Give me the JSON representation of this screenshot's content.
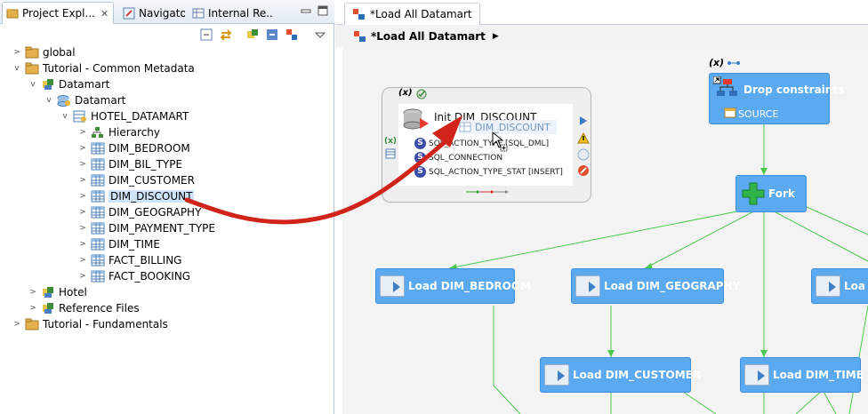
{
  "left_panel": {
    "tabs": [
      {
        "label": "Project Expl...",
        "close": "✕"
      },
      {
        "label": "Navigator"
      },
      {
        "label": "Internal Re..."
      }
    ],
    "tree": [
      {
        "label": "global"
      },
      {
        "label": "Tutorial - Common Metadata"
      },
      {
        "label": "Datamart"
      },
      {
        "label": "Datamart"
      },
      {
        "label": "HOTEL_DATAMART"
      },
      {
        "label": "Hierarchy"
      },
      {
        "label": "DIM_BEDROOM"
      },
      {
        "label": "DIM_BIL_TYPE"
      },
      {
        "label": "DIM_CUSTOMER"
      },
      {
        "label": "DIM_DISCOUNT"
      },
      {
        "label": "DIM_GEOGRAPHY"
      },
      {
        "label": "DIM_PAYMENT_TYPE"
      },
      {
        "label": "DIM_TIME"
      },
      {
        "label": "FACT_BILLING"
      },
      {
        "label": "FACT_BOOKING"
      },
      {
        "label": "Hotel"
      },
      {
        "label": "Reference Files"
      },
      {
        "label": "Tutorial - Fundamentals"
      }
    ]
  },
  "editor": {
    "tab_label": "*Load All Datamart",
    "breadcrumb": "*Load All Datamart",
    "variable_badge": "(x)",
    "init_node": {
      "title": "Init DIM_DISCOUNT",
      "drag_label": "DIM_DISCOUNT",
      "params": [
        "SQL_ACTION_TYPE [SQL_DML]",
        "SQL_CONNECTION",
        "SQL_ACTION_TYPE_STAT [INSERT]"
      ]
    },
    "drop_node": {
      "label": "Drop constraints",
      "sub": "SOURCE"
    },
    "fork_node": {
      "label": "Fork"
    },
    "load_nodes": [
      "Load DIM_BEDROOM",
      "Load DIM_GEOGRAPHY",
      "Loa",
      "Load DIM_CUSTOMER",
      "Load DIM_TIME"
    ]
  },
  "colors": {
    "node_blue": "#5aa9f1",
    "link_green": "#4cc94c",
    "drag_arrow": "#d0241b",
    "selection": "#cfe3fa"
  }
}
